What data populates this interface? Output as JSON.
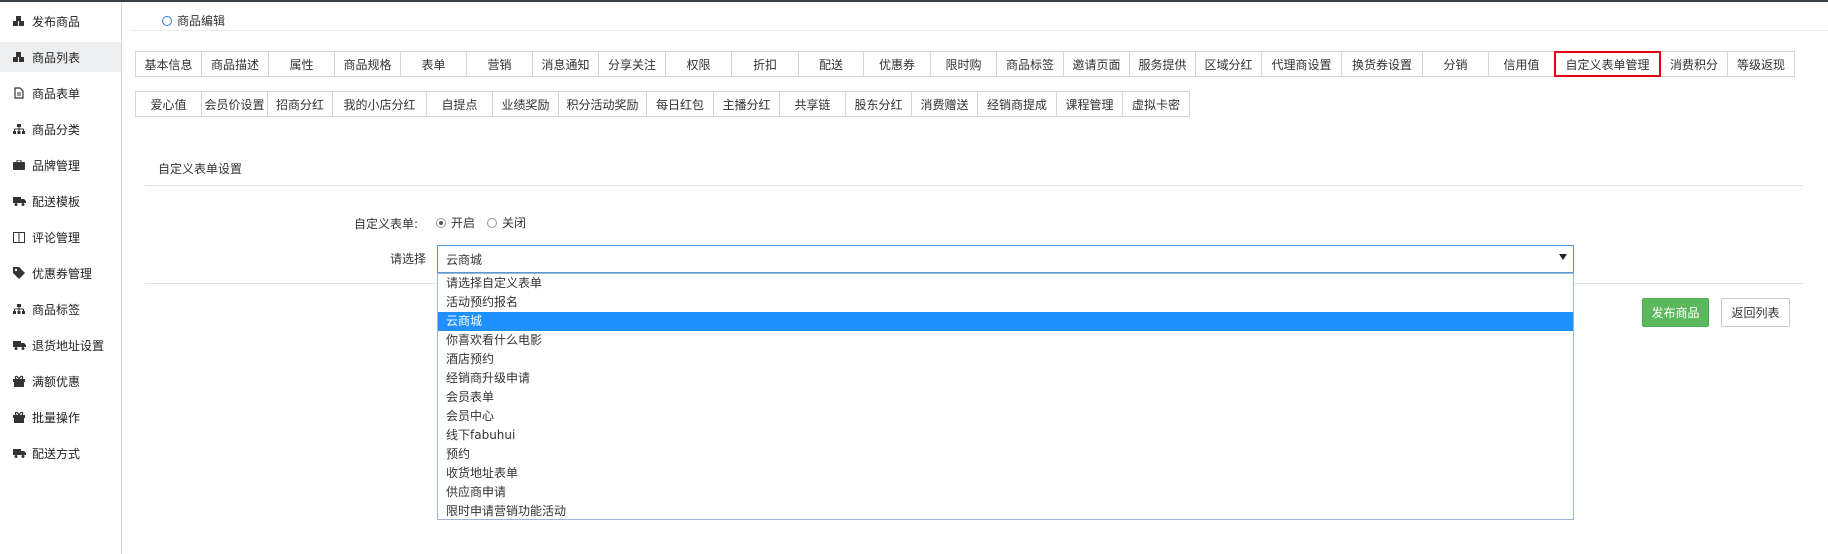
{
  "sidebar": {
    "items": [
      {
        "label": "发布商品",
        "icon": "cubes-icon"
      },
      {
        "label": "商品列表",
        "icon": "cubes-icon",
        "active": true
      },
      {
        "label": "商品表单",
        "icon": "file-icon"
      },
      {
        "label": "商品分类",
        "icon": "sitemap-icon"
      },
      {
        "label": "品牌管理",
        "icon": "briefcase-icon"
      },
      {
        "label": "配送模板",
        "icon": "truck-icon"
      },
      {
        "label": "评论管理",
        "icon": "columns-icon"
      },
      {
        "label": "优惠券管理",
        "icon": "tag-icon"
      },
      {
        "label": "商品标签",
        "icon": "sitemap-icon"
      },
      {
        "label": "退货地址设置",
        "icon": "truck-icon"
      },
      {
        "label": "满额优惠",
        "icon": "gift-icon"
      },
      {
        "label": "批量操作",
        "icon": "gift-icon"
      },
      {
        "label": "配送方式",
        "icon": "truck-icon"
      }
    ]
  },
  "breadcrumb": {
    "label": "商品编辑"
  },
  "tabs_row1": [
    "基本信息",
    "商品描述",
    "属性",
    "商品规格",
    "表单",
    "营销",
    "消息通知",
    "分享关注",
    "权限",
    "折扣",
    "配送",
    "优惠券",
    "限时购",
    "商品标签",
    "邀请页面",
    "服务提供",
    "区域分红",
    "代理商设置",
    "换货券设置",
    "分销",
    "信用值",
    "自定义表单管理",
    "消费积分",
    "等级返现"
  ],
  "tabs_row2": [
    "爱心值",
    "会员价设置",
    "招商分红",
    "我的小店分红",
    "自提点",
    "业绩奖励",
    "积分活动奖励",
    "每日红包",
    "主播分红",
    "共享链",
    "股东分红",
    "消费赠送",
    "经销商提成",
    "课程管理",
    "虚拟卡密"
  ],
  "active_tab": "自定义表单管理",
  "section": {
    "title": "自定义表单设置"
  },
  "form": {
    "custom_form_label": "自定义表单:",
    "radio_on": "开启",
    "radio_off": "关闭",
    "radio_checked": "开启",
    "select_label": "请选择",
    "select_value": "云商城",
    "options": [
      "请选择自定义表单",
      "活动预约报名",
      "云商城",
      "你喜欢看什么电影",
      "酒店预约",
      "经销商升级申请",
      "会员表单",
      "会员中心",
      "线下fabuhui",
      "预约",
      "收货地址表单",
      "供应商申请",
      "限时申请营销功能活动"
    ]
  },
  "buttons": {
    "publish": "发布商品",
    "back": "返回列表"
  },
  "colors": {
    "active_tab_border": "#e60012",
    "publish_bg": "#5cb85c",
    "selected_option_bg": "#1e90ff"
  }
}
